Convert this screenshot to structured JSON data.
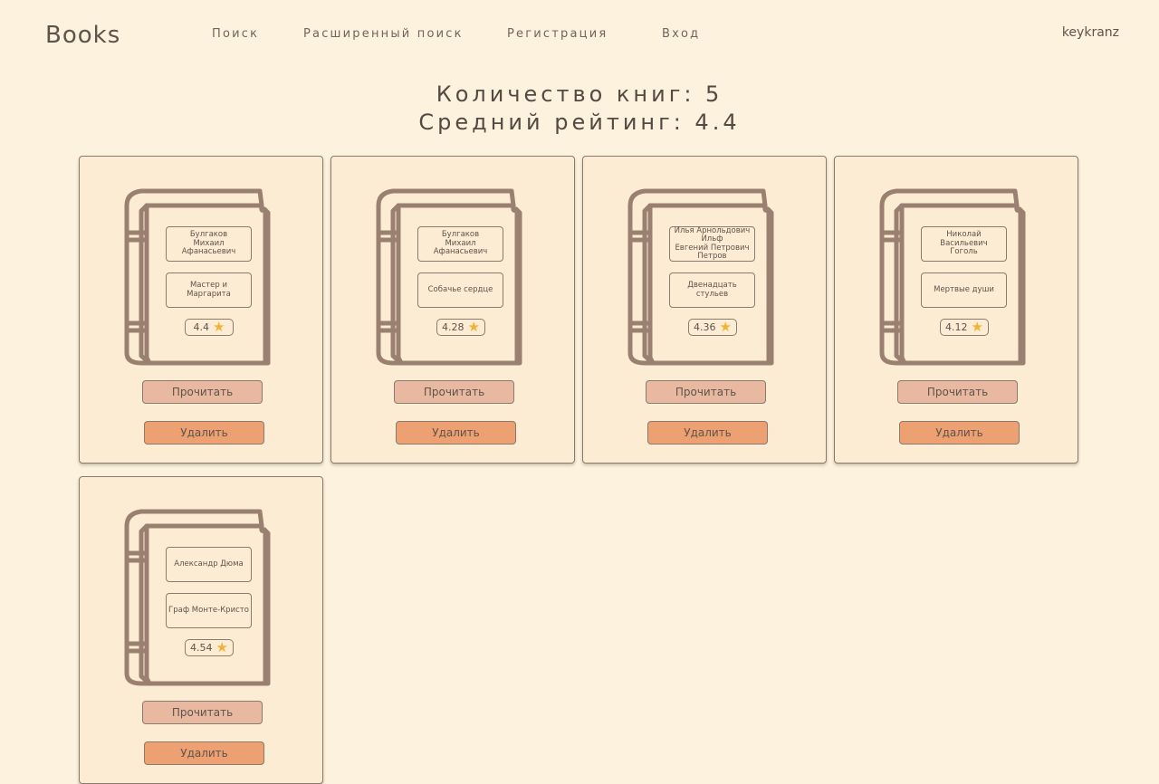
{
  "header": {
    "logo": "Books",
    "nav": [
      "Поиск",
      "Расширенный поиск",
      "Регистрация",
      "Вход"
    ],
    "username": "keykranz"
  },
  "stats": {
    "count_line": "Количество книг: 5",
    "rating_line": "Средний рейтинг: 4.4"
  },
  "books": [
    {
      "author": "Булгаков\nМихаил Афанасьевич",
      "title": "Мастер и\nМаргарита",
      "rating": "4.4",
      "read_label": "Прочитать",
      "delete_label": "Удалить"
    },
    {
      "author": "Булгаков\nМихаил Афанасьевич",
      "title": "Собачье сердце",
      "rating": "4.28",
      "read_label": "Прочитать",
      "delete_label": "Удалить"
    },
    {
      "author": "Илья Арнольдович\nИльф\nЕвгений Петрович\nПетров",
      "title": "Двенадцать\nстульев",
      "rating": "4.36",
      "read_label": "Прочитать",
      "delete_label": "Удалить"
    },
    {
      "author": "Николай Васильевич\nГоголь",
      "title": "Мертвые души",
      "rating": "4.12",
      "read_label": "Прочитать",
      "delete_label": "Удалить"
    },
    {
      "author": "Александр Дюма",
      "title": "Граф Монте-Кристо",
      "rating": "4.54",
      "read_label": "Прочитать",
      "delete_label": "Удалить"
    }
  ],
  "colors": {
    "background": "#fdf2dd",
    "card": "#fcecd4",
    "book_outline": "#9a8070",
    "read_button": "#e8b9a0",
    "delete_button": "#eda071",
    "star": "#f2b236"
  }
}
